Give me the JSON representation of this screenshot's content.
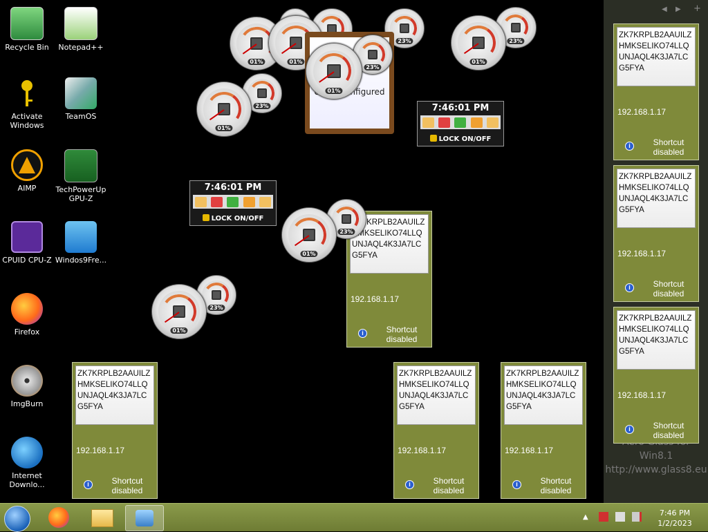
{
  "desktop_icons": [
    {
      "label": "Recycle Bin",
      "icon": "recycle-bin-icon"
    },
    {
      "label": "Notepad++",
      "icon": "notepadpp-icon"
    },
    {
      "label": "Activate Windows",
      "icon": "key-icon"
    },
    {
      "label": "TeamOS",
      "icon": "teamos-icon"
    },
    {
      "label": "AIMP",
      "icon": "aimp-icon"
    },
    {
      "label": "TechPowerUp GPU-Z",
      "icon": "gpuz-icon"
    },
    {
      "label": "CPUID CPU-Z",
      "icon": "cpuz-icon"
    },
    {
      "label": "Windos9Fre...",
      "icon": "windos9-icon"
    },
    {
      "label": "Firefox",
      "icon": "firefox-icon"
    },
    {
      "label": "ImgBurn",
      "icon": "imgburn-icon"
    },
    {
      "label": "Internet Downlo...",
      "icon": "idm-icon"
    }
  ],
  "key_gadget": {
    "code": "ZK7KRPLB2AAUILZHMKSELIKO74LLQUNJAQL4K3JA7LCG5FYA",
    "ip": "192.168.1.17",
    "status": "Shortcut disabled"
  },
  "gauges": {
    "cpu_pct": "01%",
    "mem_pct": "23%"
  },
  "clock_gadget": {
    "time": "7:46:01 PM",
    "lock_label": "LOCK ON/OFF"
  },
  "event_note": {
    "text": "event configured"
  },
  "watermark": {
    "line1": "Aero Glass for Win8.1",
    "line2": "http://www.glass8.eu"
  },
  "taskbar": {
    "time": "7:46 PM",
    "date": "1/2/2023"
  }
}
